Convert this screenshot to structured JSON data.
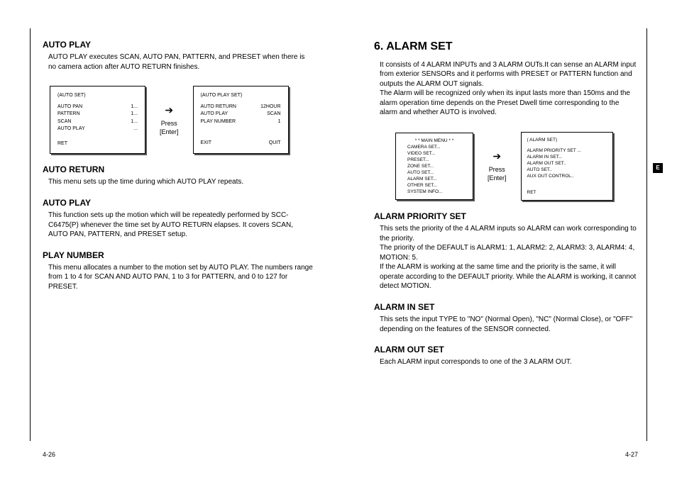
{
  "left": {
    "sec1_title": "AUTO PLAY",
    "sec1_body": "AUTO PLAY executes SCAN, AUTO PAN, PATTERN, and PRESET when there is no camera action after AUTO RETURN finishes.",
    "screen1": {
      "title": "(AUTO SET)",
      "r1a": "AUTO PAN",
      "r1b": "1...",
      "r2a": "PATTERN",
      "r2b": "1...",
      "r3a": "SCAN",
      "r3b": "1...",
      "r4a": "AUTO PLAY",
      "r4b": "...",
      "footer": "RET"
    },
    "arrow": {
      "glyph": "➔",
      "l1": "Press",
      "l2": "[Enter]"
    },
    "screen2": {
      "title": "(AUTO PLAY SET)",
      "r1a": "AUTO RETURN",
      "r1b": "12HOUR",
      "r2a": "AUTO PLAY",
      "r2b": "SCAN",
      "r3a": "PLAY NUMBER",
      "r3b": "1",
      "fL": "EXIT",
      "fR": "QUIT"
    },
    "sec2_title": "AUTO RETURN",
    "sec2_body": "This menu sets up the time during which AUTO PLAY repeats.",
    "sec3_title": "AUTO PLAY",
    "sec3_body": "This function sets up the motion which will be repeatedly performed by SCC-C6475(P) whenever the time set by AUTO RETURN elapses. It covers SCAN, AUTO PAN, PATTERN, and PRESET setup.",
    "sec4_title": "PLAY NUMBER",
    "sec4_body": "This menu allocates a number to the motion set by AUTO PLAY. The numbers range from 1 to 4 for SCAN AND AUTO PAN, 1 to 3 for PATTERN, and 0 to 127 for PRESET.",
    "page_num": "4-26"
  },
  "right": {
    "h_title": "6. ALARM SET",
    "intro": "It consists of 4 ALARM INPUTs and 3 ALARM OUTs.It can sense an ALARM input from exterior SENSORs and it performs with PRESET or PATTERN function and outputs the ALARM OUT signals.\nThe Alarm will be recognized only when its input lasts more than 150ms and the alarm operation time depends on the Preset Dwell time corresponding to the alarm and whether AUTO is involved.",
    "screen1": {
      "title": "* *  MAIN MENU  * *",
      "i1": "CAMERA SET...",
      "i2": "VIDEO SET...",
      "i3": "PRESET...",
      "i4": "ZONE SET...",
      "i5": "AUTO SET...",
      "i6": "ALARM SET...",
      "i7": "OTHER SET...",
      "i8": "SYSTEM INFO..."
    },
    "arrow": {
      "glyph": "➔",
      "l1": "Press",
      "l2": "[Enter]"
    },
    "screen2": {
      "title": "( ALARM SET)",
      "i1": "ALARM PRIORITY SET ...",
      "i2": "ALARM IN SET...",
      "i3": "ALARM OUT SET..",
      "i4": "AUTO SET..",
      "i5": "AUX OUT CONTROL..",
      "footer": "RET"
    },
    "sec1_title": "ALARM PRIORITY SET",
    "sec1_body": "This sets the priority of the 4 ALARM inputs so ALARM can work corresponding to the priority.\nThe priority of the DEFAULT is ALARM1: 1, ALARM2: 2, ALARM3: 3, ALARM4: 4, MOTION: 5.\nIf the ALARM is working at the same time and the priority is the same, it will operate according to the DEFAULT priority.  While the ALARM is working, it cannot detect MOTION.",
    "sec2_title": "ALARM IN SET",
    "sec2_body": "This sets the input TYPE to \"NO\" (Normal Open), \"NC\" (Normal Close), or \"OFF\" depending on the features of the SENSOR connected.",
    "sec3_title": "ALARM OUT SET",
    "sec3_body": "Each ALARM input corresponds to one of the 3 ALARM OUT.",
    "page_num": "4-27",
    "tab": "E"
  }
}
